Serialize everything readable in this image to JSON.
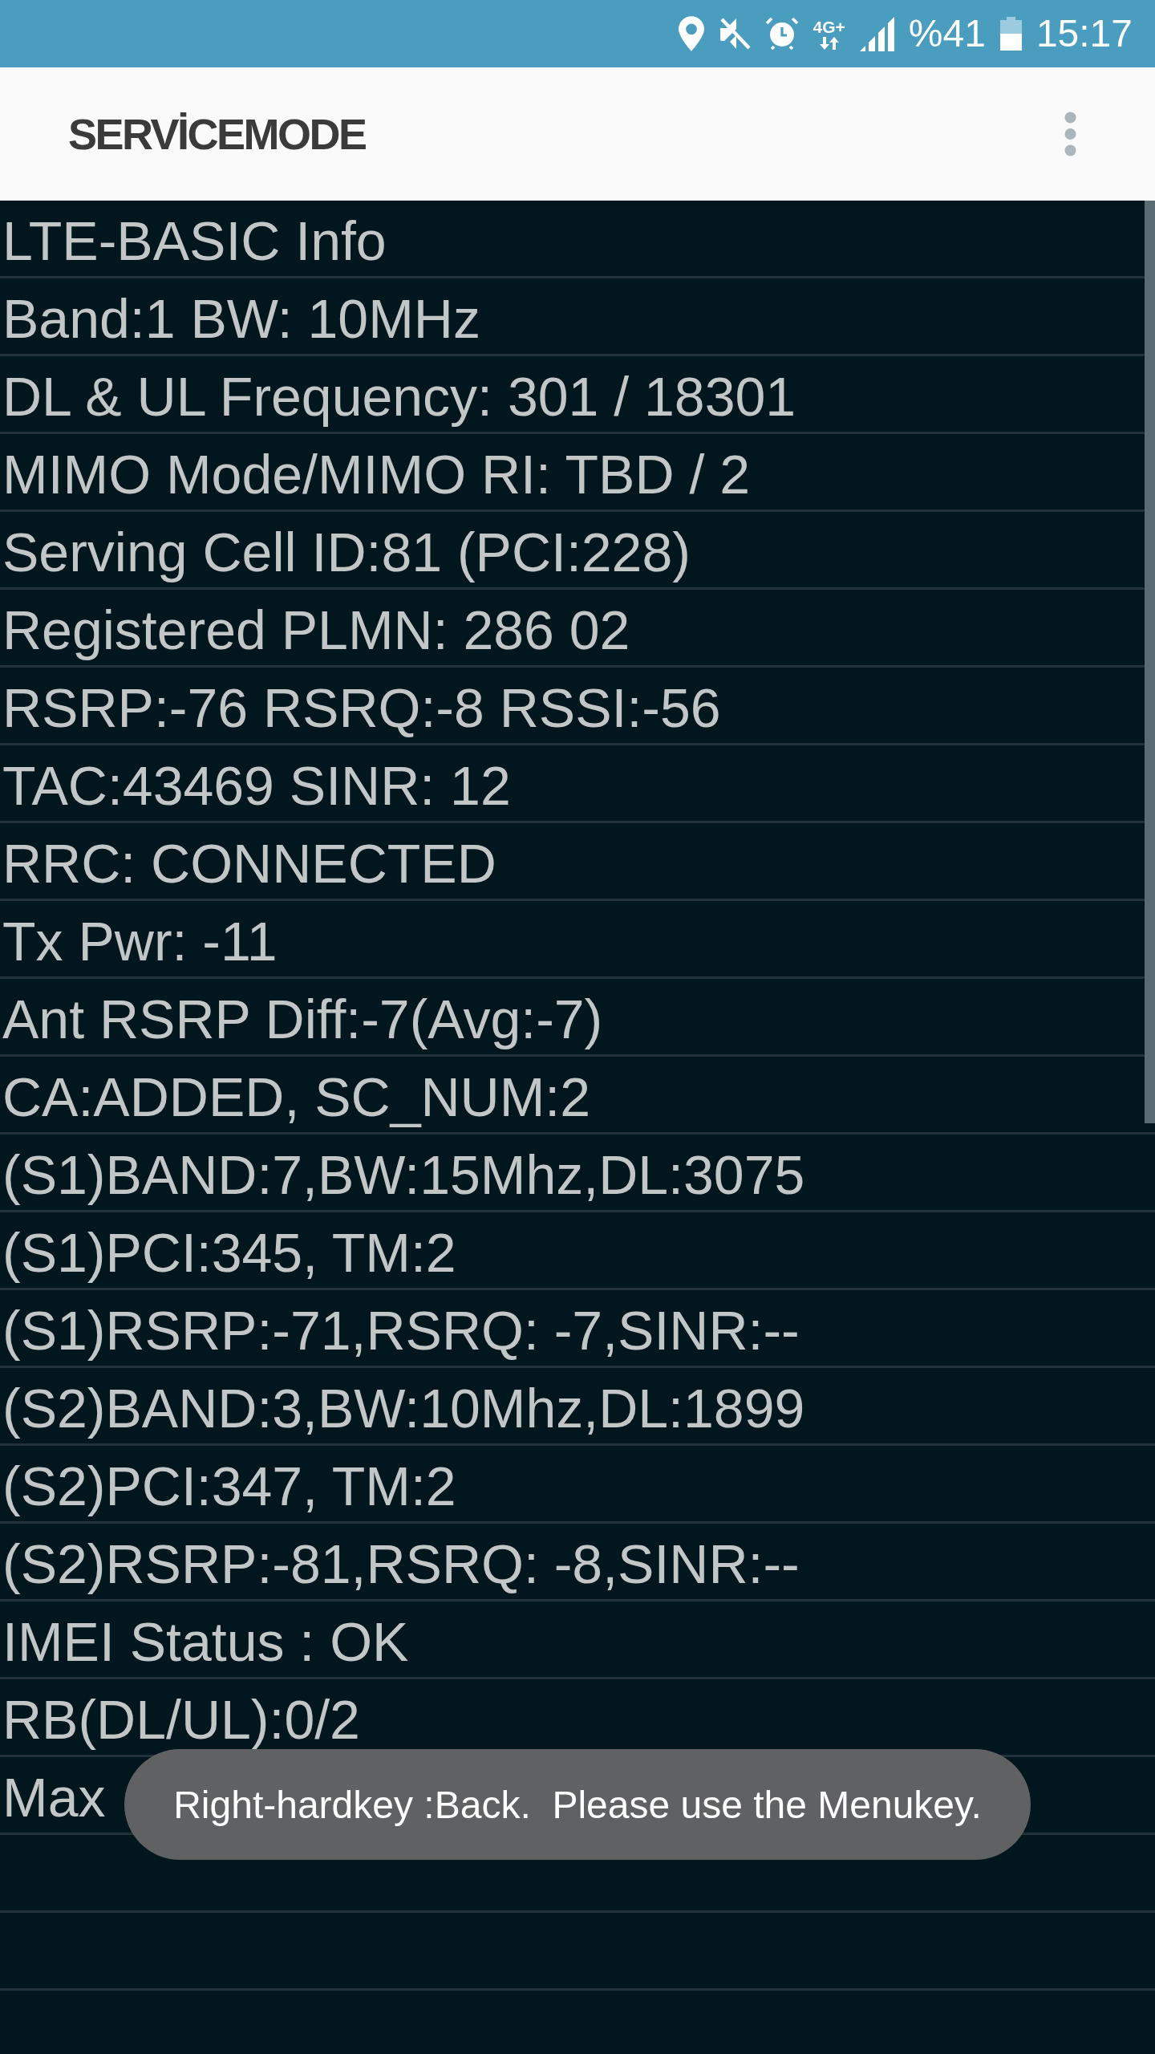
{
  "status_bar": {
    "network_type": "4G+",
    "battery": "%41",
    "time": "15:17"
  },
  "app_bar": {
    "title": "SERVİCEMODE"
  },
  "lines": [
    "LTE-BASIC Info",
    "Band:1 BW: 10MHz",
    "DL & UL Frequency: 301 / 18301",
    "MIMO Mode/MIMO RI: TBD / 2",
    "Serving Cell ID:81 (PCI:228)",
    "Registered PLMN: 286 02",
    "RSRP:-76 RSRQ:-8 RSSI:-56",
    "TAC:43469 SINR: 12",
    "RRC: CONNECTED",
    "Tx Pwr: -11",
    "Ant RSRP Diff:-7(Avg:-7)",
    "CA:ADDED, SC_NUM:2",
    "(S1)BAND:7,BW:15Mhz,DL:3075",
    "(S1)PCI:345, TM:2",
    "(S1)RSRP:-71,RSRQ: -7,SINR:--",
    "(S2)BAND:3,BW:10Mhz,DL:1899",
    "(S2)PCI:347, TM:2",
    "(S2)RSRP:-81,RSRQ: -8,SINR:--",
    "IMEI Status : OK",
    "RB(DL/UL):0/2",
    "Max"
  ],
  "toast": {
    "message": "Right-hardkey :Back.  Please use the Menukey."
  }
}
